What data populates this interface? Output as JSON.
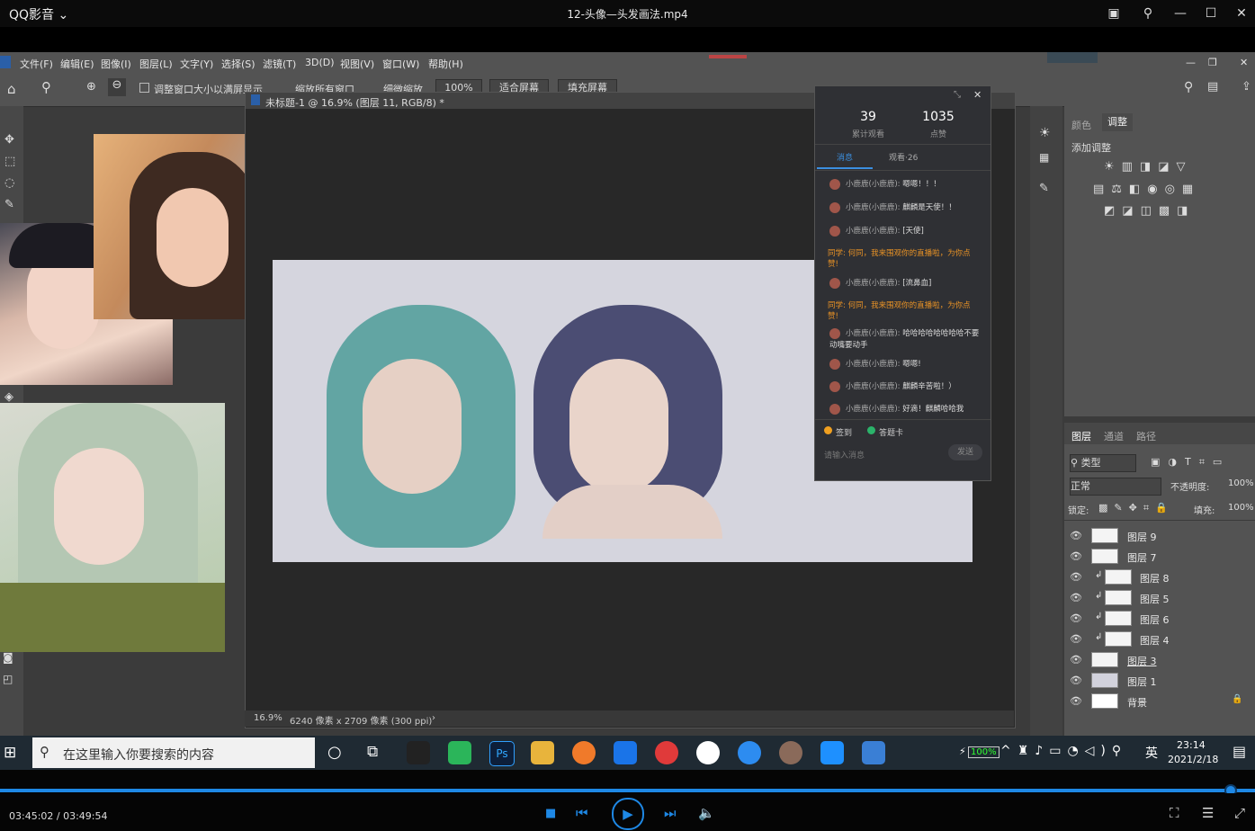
{
  "player": {
    "app_name": "QQ影音",
    "app_name_chevron": "⌄",
    "video_title": "12-头像—头发画法.mp4",
    "time_display": "03:45:02 / 03:49:54",
    "progress": 0.981,
    "accent_color": "#1e88e5"
  },
  "ps": {
    "menus": [
      "文件(F)",
      "编辑(E)",
      "图像(I)",
      "图层(L)",
      "文字(Y)",
      "选择(S)",
      "滤镜(T)",
      "3D(D)",
      "视图(V)",
      "窗口(W)",
      "帮助(H)"
    ],
    "options": {
      "resize_label": "调整窗口大小以满屏显示",
      "zoom_all_label": "缩放所有窗口",
      "scrubby_label": "细微缩放",
      "zoom_value": "100%",
      "fit_screen": "适合屏幕",
      "fill_screen": "填充屏幕"
    },
    "doc_tab": "未标题-1 @ 16.9% (图层 11, RGB/8) *",
    "status": {
      "zoom": "16.9%",
      "size": "6240 像素 x 2709 像素 (300 ppi)",
      "arrow": "›"
    },
    "adjustments": {
      "tab_color": "颜色",
      "tab_adjust": "调整",
      "add_label": "添加调整"
    },
    "layers_panel": {
      "tabs": [
        "图层",
        "通道",
        "路径"
      ],
      "filter_kind": "类型",
      "blend_mode": "正常",
      "opacity_label": "不透明度:",
      "opacity_value": "100%",
      "lock_label": "锁定:",
      "fill_label": "填充:",
      "fill_value": "100%",
      "layers": [
        {
          "name": "图层 9",
          "clipped": false
        },
        {
          "name": "图层 7",
          "clipped": false
        },
        {
          "name": "图层 8",
          "clipped": true
        },
        {
          "name": "图层 5",
          "clipped": true
        },
        {
          "name": "图层 6",
          "clipped": true
        },
        {
          "name": "图层 4",
          "clipped": true
        },
        {
          "name": "图层 3",
          "clipped": false
        },
        {
          "name": "图层 1",
          "clipped": false
        },
        {
          "name": "背景",
          "clipped": false
        }
      ]
    }
  },
  "chat": {
    "viewers_count": "39",
    "viewers_label": "累计观看",
    "likes_count": "1035",
    "likes_label": "点赞",
    "tab_messages": "消息",
    "tab_viewers": "观看·26",
    "messages": [
      {
        "user": "小鹿鹿(小鹿鹿):",
        "text": "嗯嗯！！！",
        "highlight": false
      },
      {
        "user": "小鹿鹿(小鹿鹿):",
        "text": "麒麟是天使！！",
        "highlight": false
      },
      {
        "user": "小鹿鹿(小鹿鹿):",
        "text": "[天使]",
        "highlight": false
      },
      {
        "user": "同学:",
        "text": "何同，我来围观你的直播啦，为你点赞!",
        "highlight": true
      },
      {
        "user": "小鹿鹿(小鹿鹿):",
        "text": "[流鼻血]",
        "highlight": false
      },
      {
        "user": "同学:",
        "text": "何同，我来围观你的直播啦，为你点赞!",
        "highlight": true
      },
      {
        "user": "小鹿鹿(小鹿鹿):",
        "text": "哈哈哈哈哈哈哈哈不要动嘴要动手",
        "highlight": false
      },
      {
        "user": "小鹿鹿(小鹿鹿):",
        "text": "嗯嗯!",
        "highlight": false
      },
      {
        "user": "小鹿鹿(小鹿鹿):",
        "text": "麒麟辛苦啦！）",
        "highlight": false
      },
      {
        "user": "小鹿鹿(小鹿鹿):",
        "text": "好滴！麒麟哈哈我",
        "highlight": false
      }
    ],
    "sign_in": "签到",
    "checkin": "答题卡",
    "input_placeholder": "请输入消息",
    "send": "发送"
  },
  "taskbar": {
    "search_placeholder": "在这里输入你要搜索的内容",
    "battery": "100%",
    "ime": "英",
    "time": "23:14",
    "date": "2021/2/18"
  }
}
